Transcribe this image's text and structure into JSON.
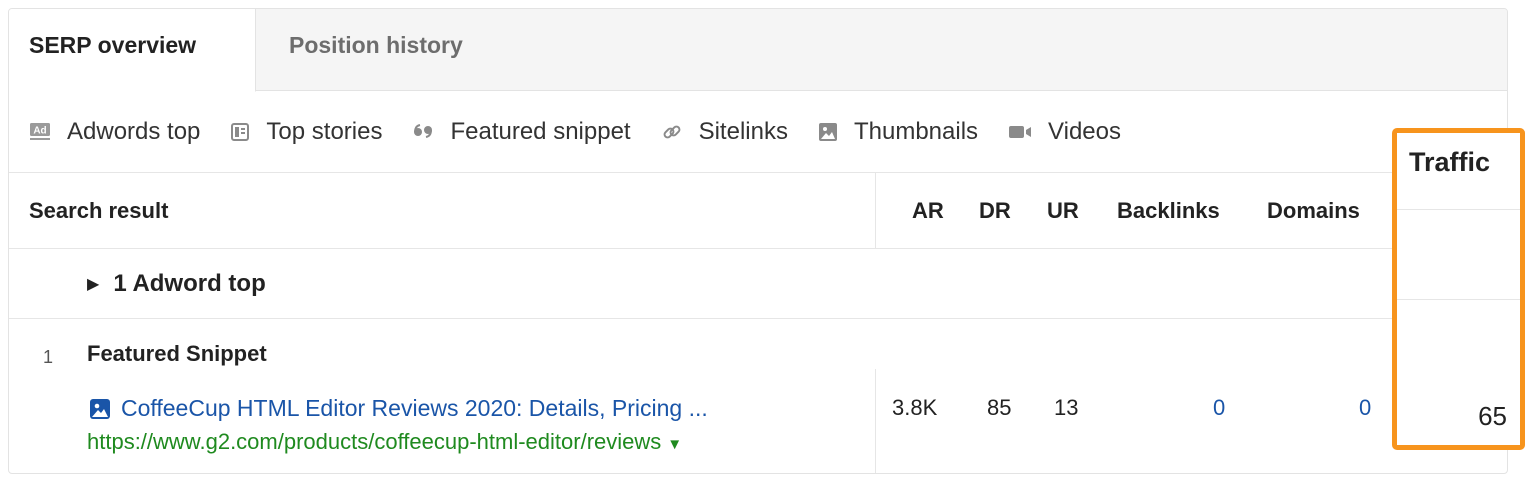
{
  "tabs": [
    {
      "label": "SERP overview",
      "active": true
    },
    {
      "label": "Position history",
      "active": false
    }
  ],
  "filters": [
    {
      "icon": "ad-icon",
      "label": "Adwords top"
    },
    {
      "icon": "newspaper-icon",
      "label": "Top stories"
    },
    {
      "icon": "quote-icon",
      "label": "Featured snippet"
    },
    {
      "icon": "link-icon",
      "label": "Sitelinks"
    },
    {
      "icon": "image-icon",
      "label": "Thumbnails"
    },
    {
      "icon": "video-camera-icon",
      "label": "Videos"
    }
  ],
  "table": {
    "headers": {
      "result": "Search result",
      "ar": "AR",
      "dr": "DR",
      "ur": "UR",
      "backlinks": "Backlinks",
      "domains": "Domains",
      "traffic": "Traffic"
    },
    "adword_group": "1 Adword top",
    "rows": [
      {
        "position": "1",
        "feature": "Featured Snippet",
        "title": "CoffeeCup HTML Editor Reviews 2020: Details, Pricing ...",
        "url": "https://www.g2.com/products/coffeecup-html-editor/reviews",
        "ar": "3.8K",
        "dr": "85",
        "ur": "13",
        "backlinks": "0",
        "domains": "0",
        "traffic": "65"
      }
    ]
  },
  "colors": {
    "highlight": "#f7941d",
    "link": "#1a55a8",
    "url": "#1f8a1f"
  }
}
